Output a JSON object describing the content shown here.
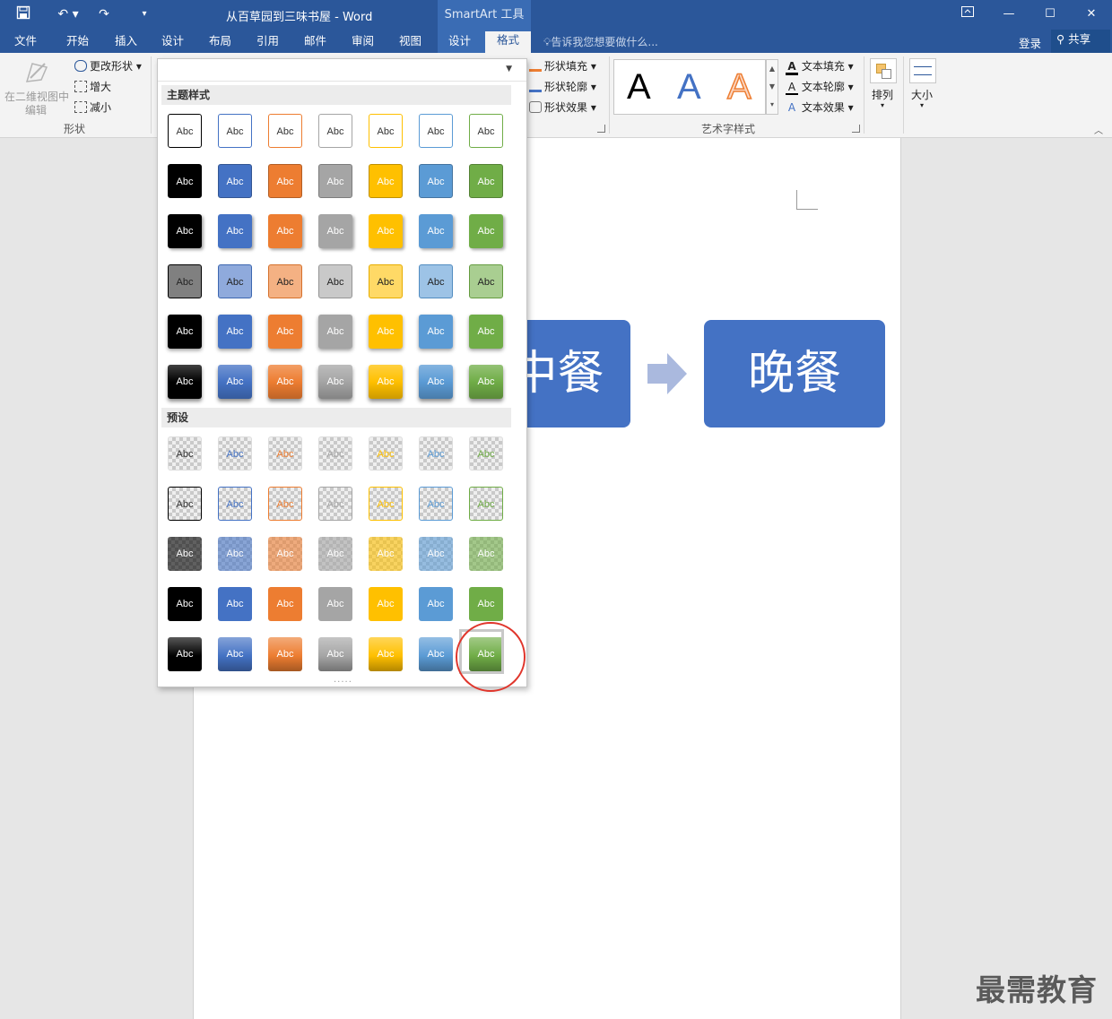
{
  "window": {
    "doc_title": "从百草园到三味书屋 - Word",
    "context_label": "SmartArt 工具",
    "minimize": "—",
    "restore": "☐",
    "close": "✕"
  },
  "tabs": [
    "文件",
    "开始",
    "插入",
    "设计",
    "布局",
    "引用",
    "邮件",
    "审阅",
    "视图",
    "设计"
  ],
  "active_tab": "格式",
  "tell_me": "告诉我您想要做什么...",
  "login": "登录",
  "share": "共享",
  "ribbon": {
    "shapes_group": {
      "edit_2d": "在二维视图中",
      "edit_2d_line2": "编辑",
      "change_shape": "更改形状",
      "enlarge": "增大",
      "shrink": "减小",
      "label": "形状"
    },
    "shape_styles": {
      "fill": "形状填充",
      "outline": "形状轮廓",
      "effects": "形状效果"
    },
    "wordart": {
      "letter": "A",
      "text_fill": "文本填充",
      "text_outline": "文本轮廓",
      "text_effects": "文本效果",
      "label": "艺术字样式"
    },
    "arrange": "排列",
    "size": "大小"
  },
  "gallery": {
    "section_theme": "主题样式",
    "section_preset": "预设",
    "cell_label": "Abc",
    "colors": [
      "#000000",
      "#4472c4",
      "#ed7d31",
      "#a5a5a5",
      "#ffc000",
      "#5b9bd5",
      "#70ad47"
    ],
    "selected": {
      "section": "preset",
      "row": 5,
      "col": 7
    }
  },
  "smartart": {
    "box_partial": "中餐",
    "box_right": "晚餐",
    "box_color": "#4472c4",
    "arrow_color": "#aab9de"
  },
  "watermark": "最需教育"
}
